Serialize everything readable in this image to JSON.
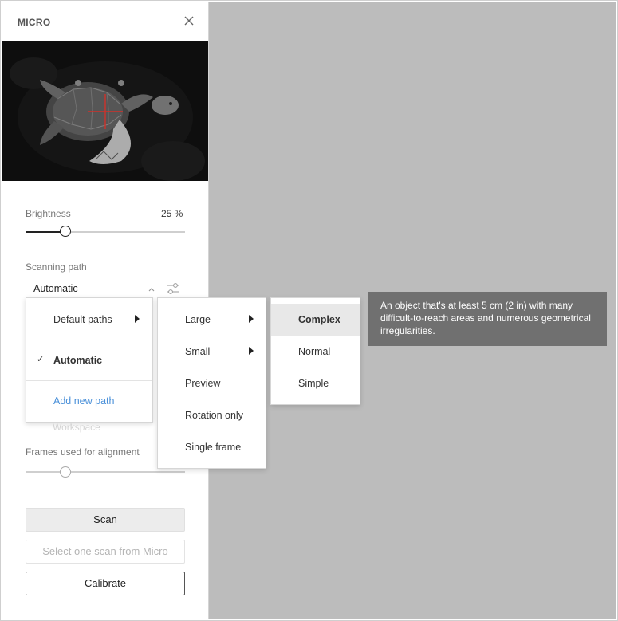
{
  "panel": {
    "title": "MICRO",
    "brightness_label": "Brightness",
    "brightness_value": "25 %",
    "brightness_level": 0.25,
    "scanning_path_label": "Scanning path",
    "scanning_path_value": "Automatic",
    "workspace_label": "Workspace",
    "frames_label": "Frames used for alignment",
    "frames_level": 0.25,
    "scan_label": "Scan",
    "select_scan_label": "Select one scan from Micro",
    "calibrate_label": "Calibrate"
  },
  "menu1": {
    "items": [
      "Default paths",
      "Automatic",
      "Add new path"
    ]
  },
  "menu2": {
    "items": [
      "Large",
      "Small",
      "Preview",
      "Rotation only",
      "Single frame"
    ]
  },
  "menu3": {
    "items": [
      "Complex",
      "Normal",
      "Simple"
    ]
  },
  "tooltip": {
    "text": "An object that's at least 5 cm (2 in) with many difficult-to-reach areas and numerous geometrical irregularities."
  },
  "colors": {
    "workspace": "#bcbcbc",
    "link": "#4a90d9",
    "tooltip_bg": "#707070",
    "crosshair": "#d0302a"
  }
}
